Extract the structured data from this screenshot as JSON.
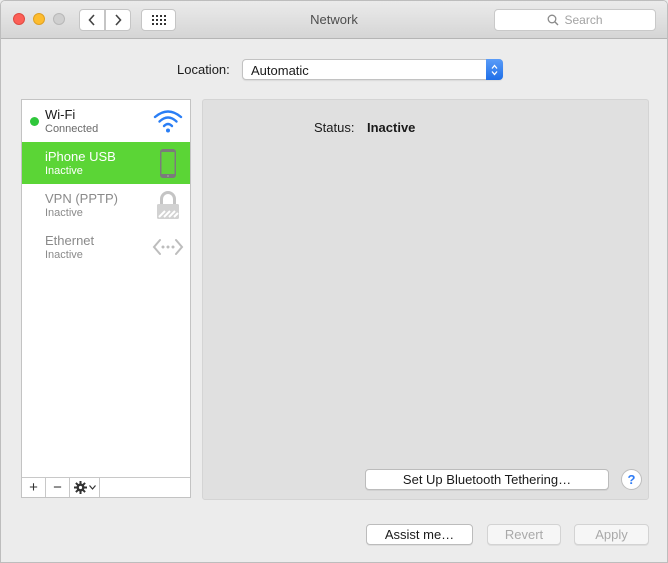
{
  "window": {
    "title": "Network"
  },
  "toolbar": {
    "back_icon": "chevron-left-icon",
    "forward_icon": "chevron-right-icon",
    "grid_icon": "show-all-grid-icon",
    "search_placeholder": "Search"
  },
  "location": {
    "label": "Location:",
    "value": "Automatic"
  },
  "services": [
    {
      "name": "Wi-Fi",
      "status": "Connected",
      "icon": "wifi-icon",
      "indicator": "#2fc73b"
    },
    {
      "name": "iPhone USB",
      "status": "Inactive",
      "icon": "iphone-icon",
      "selected": true
    },
    {
      "name": "VPN (PPTP)",
      "status": "Inactive",
      "icon": "lock-icon"
    },
    {
      "name": "Ethernet",
      "status": "Inactive",
      "icon": "ethernet-icon"
    }
  ],
  "list_toolbar": {
    "add": "+",
    "remove": "−",
    "action_icon": "gear-icon"
  },
  "detail": {
    "status_label": "Status:",
    "status_value": "Inactive",
    "bluetooth_button": "Set Up Bluetooth Tethering…",
    "help": "?"
  },
  "footer": {
    "assist": "Assist me…",
    "revert": "Revert",
    "apply": "Apply"
  },
  "colors": {
    "selection": "#5bd536",
    "accent": "#1f6fe8",
    "close": "#fc5f57",
    "minimize": "#fdbc2e"
  }
}
